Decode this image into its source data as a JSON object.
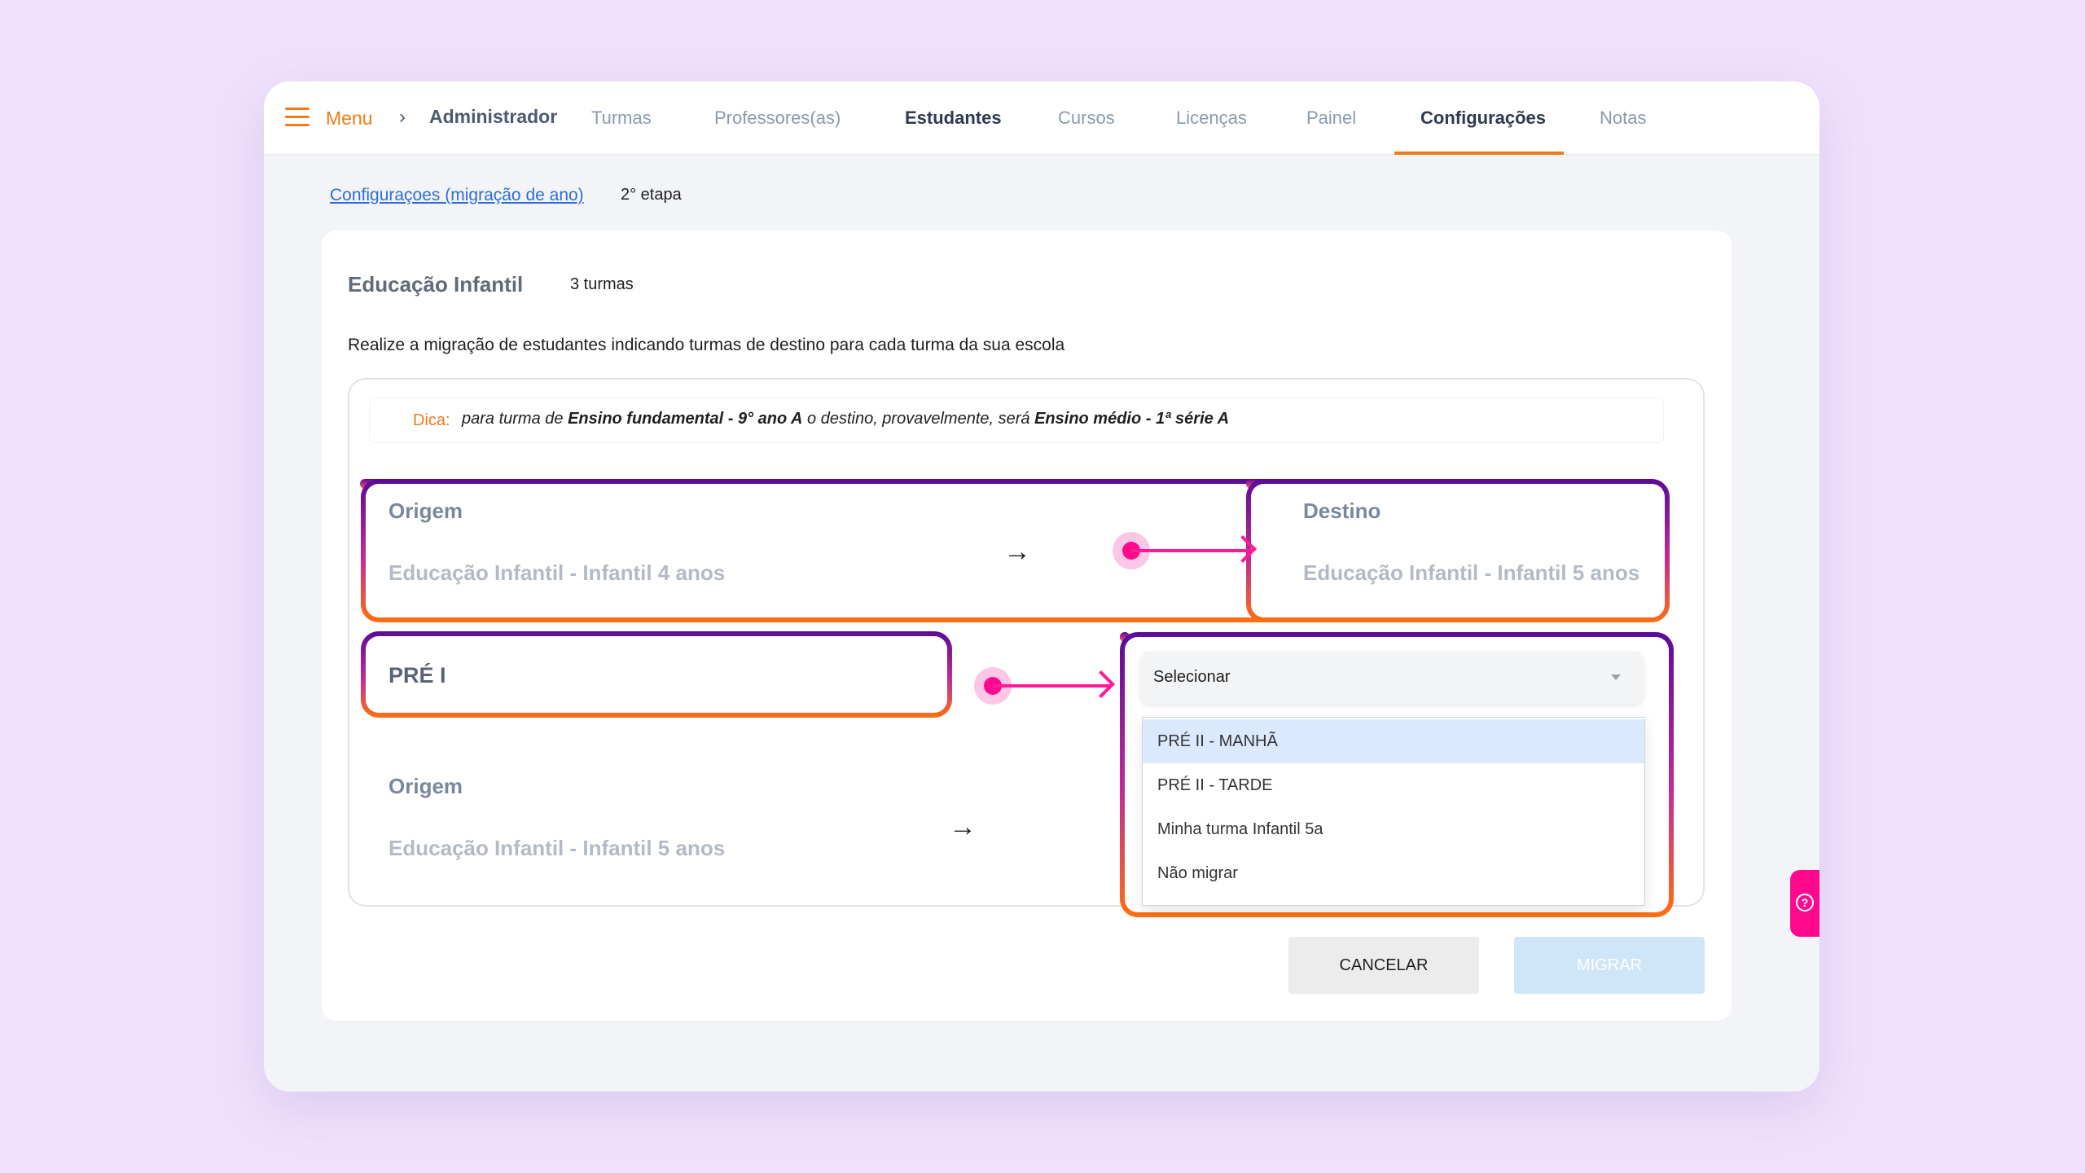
{
  "nav": {
    "menu_label": "Menu",
    "breadcrumb_root": "Administrador",
    "items": [
      {
        "label": "Turmas"
      },
      {
        "label": "Professores(as)"
      },
      {
        "label": "Estudantes"
      },
      {
        "label": "Cursos"
      },
      {
        "label": "Licenças"
      },
      {
        "label": "Painel"
      },
      {
        "label": "Configurações"
      },
      {
        "label": "Notas"
      }
    ],
    "active": "Configurações",
    "accent": "#f07a1a"
  },
  "breadcrumb": {
    "link": "Configuraçoes (migração de ano)",
    "step": "2° etapa"
  },
  "card": {
    "title": "Educação Infantil",
    "count": "3 turmas",
    "description": "Realize a migração de estudantes indicando turmas de destino para cada turma da sua escola"
  },
  "tip": {
    "label": "Dica:",
    "text_1": "para turma de ",
    "bold_1": "Ensino fundamental - 9° ano A",
    "text_2": " o destino, provavelmente, será ",
    "bold_2": "Ensino médio - 1ª série A"
  },
  "row1": {
    "origin_title": "Origem",
    "origin_value": "Educação Infantil - Infantil 4 anos",
    "dest_title": "Destino",
    "dest_value": "Educação Infantil - Infantil 5 anos"
  },
  "row2": {
    "class_name": "PRÉ I",
    "select_value": "Selecionar",
    "options": [
      {
        "label": "PRÉ II - MANHÃ"
      },
      {
        "label": "PRÉ II - TARDE"
      },
      {
        "label": "Minha turma Infantil 5a"
      },
      {
        "label": "Não migrar"
      }
    ],
    "highlighted_option": "PRÉ II - MANHÃ"
  },
  "row3": {
    "origin_title": "Origem",
    "origin_value": "Educação Infantil - Infantil 5 anos"
  },
  "actions": {
    "cancel": "CANCELAR",
    "submit": "MIGRAR"
  },
  "colors": {
    "highlight_pink": "#ff0a8f",
    "gradient_top": "#5b0c96",
    "gradient_bottom": "#ff6f0f",
    "background": "#efe1fc"
  }
}
